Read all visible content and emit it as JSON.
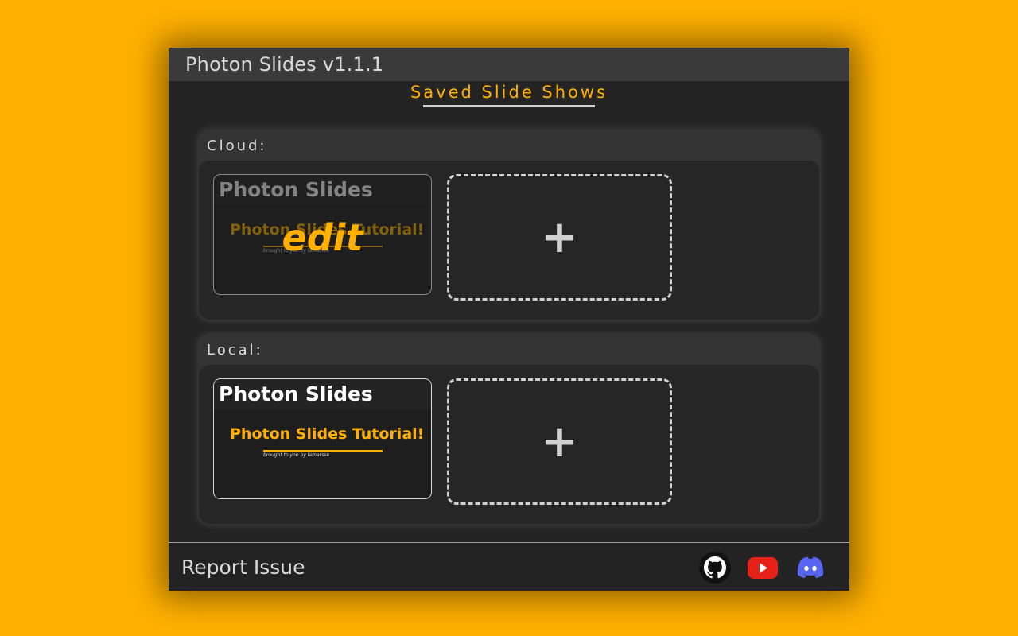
{
  "window": {
    "title": "Photon Slides v1.1.1"
  },
  "heading": "Saved Slide Shows",
  "cloud": {
    "label": "Cloud:",
    "slides": [
      {
        "title": "Photon Slides",
        "preview_title": "Photon Slides Tutorial!",
        "preview_subtitle": "brought to you by lamarsse",
        "overlay": "edit"
      }
    ],
    "add_label": "+"
  },
  "local": {
    "label": "Local:",
    "slides": [
      {
        "title": "Photon Slides",
        "preview_title": "Photon Slides Tutorial!",
        "preview_subtitle": "brought to you by lamarsse"
      }
    ],
    "add_label": "+"
  },
  "footer": {
    "report": "Report Issue",
    "social": [
      "github-icon",
      "youtube-icon",
      "discord-icon"
    ]
  },
  "colors": {
    "accent": "#FFB000",
    "background": "#242424",
    "youtube": "#E62117",
    "discord": "#5865F2"
  }
}
